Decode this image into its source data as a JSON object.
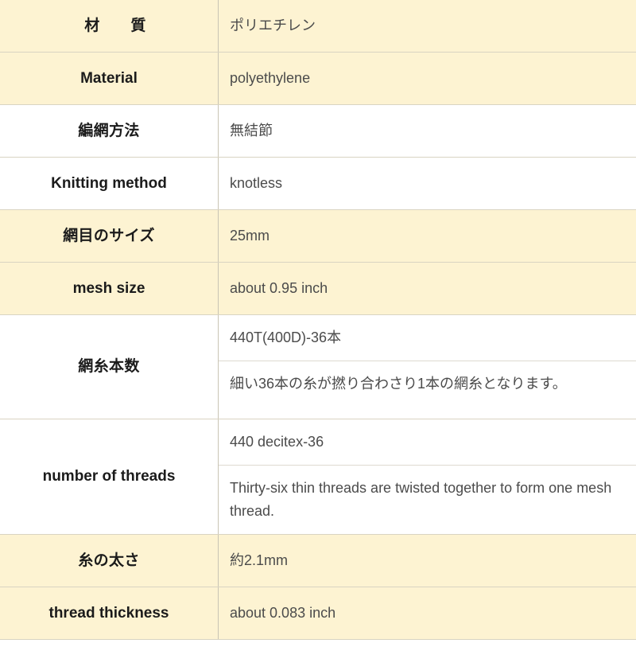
{
  "table": {
    "title": "product specification table",
    "colors": {
      "cream_row": "#fdf3d2",
      "white_row": "#ffffff",
      "border": "#d9d4c2",
      "label_text": "#1b1b1b",
      "value_text": "#4b4b4b"
    },
    "rows": [
      {
        "label": "材　　質",
        "value": "ポリエチレン",
        "background": "cream",
        "label_lang": "ja",
        "split": false
      },
      {
        "label": "Material",
        "value": "polyethylene",
        "background": "cream",
        "label_lang": "en",
        "split": false
      },
      {
        "label": "編網方法",
        "value": "無結節",
        "background": "white",
        "label_lang": "ja",
        "split": false
      },
      {
        "label": "Knitting method",
        "value": "knotless",
        "background": "white",
        "label_lang": "en",
        "split": false
      },
      {
        "label": "網目のサイズ",
        "value": "25mm",
        "background": "cream",
        "label_lang": "ja",
        "split": false
      },
      {
        "label": "mesh size",
        "value": "about 0.95 inch",
        "background": "cream",
        "label_lang": "en",
        "split": false
      },
      {
        "label": "網糸本数",
        "value_top": "440T(400D)-36本",
        "value_bottom": "細い36本の糸が撚り合わさり1本の網糸となります。",
        "background": "white",
        "label_lang": "ja",
        "split": true
      },
      {
        "label": "number of threads",
        "value_top": "440 decitex-36",
        "value_bottom": "Thirty-six thin threads are twisted together to form one mesh thread.",
        "background": "white",
        "label_lang": "en",
        "split": true
      },
      {
        "label": "糸の太さ",
        "value": "約2.1mm",
        "background": "cream",
        "label_lang": "ja",
        "split": false
      },
      {
        "label": "thread thickness",
        "value": "about 0.083 inch",
        "background": "cream",
        "label_lang": "en",
        "split": false
      }
    ]
  }
}
